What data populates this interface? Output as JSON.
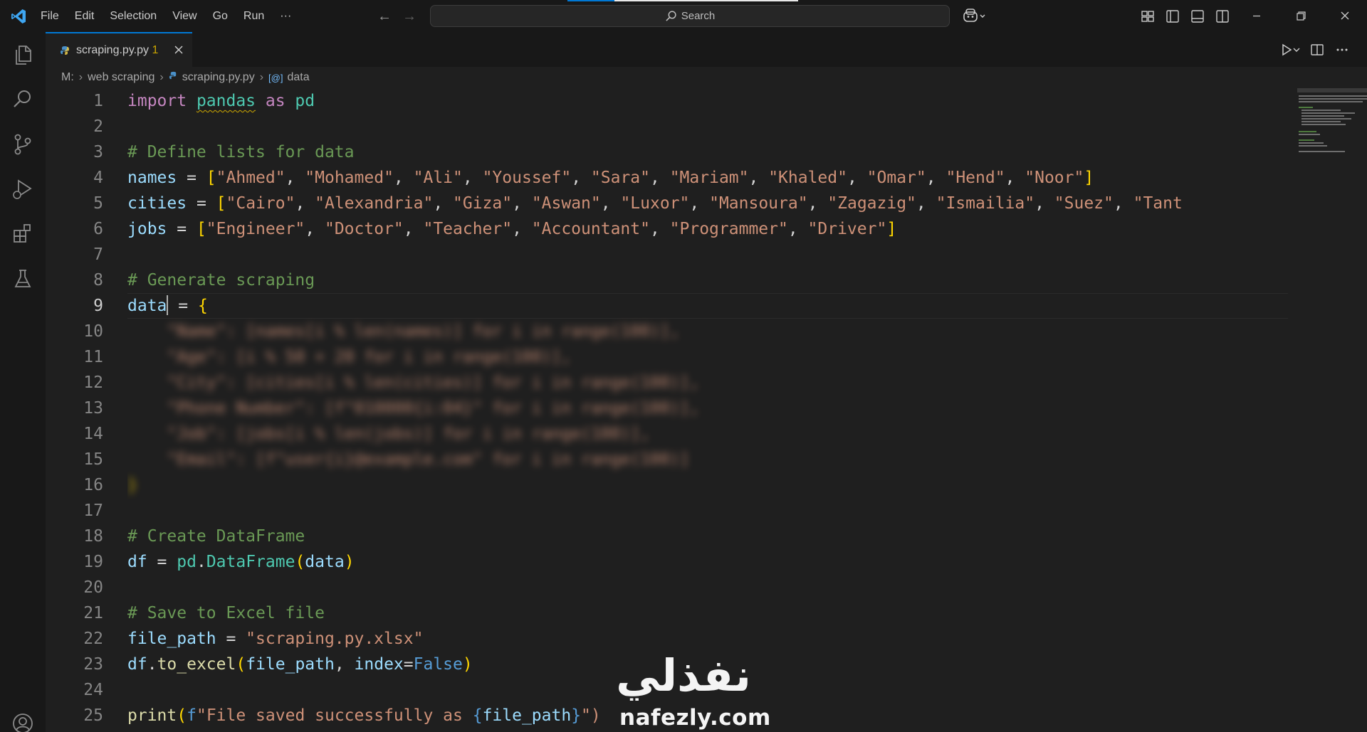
{
  "titlebar": {
    "menu": [
      "File",
      "Edit",
      "Selection",
      "View",
      "Go",
      "Run",
      "···"
    ],
    "search_label": "Search"
  },
  "activity_icons": [
    "explorer-icon",
    "search-icon",
    "source-control-icon",
    "run-debug-icon",
    "extensions-icon",
    "testing-icon",
    "accounts-icon"
  ],
  "tab": {
    "name": "scraping.py.py",
    "problems_count": "1"
  },
  "breadcrumb": {
    "drive": "M:",
    "folder": "web scraping",
    "file": "scraping.py.py",
    "symbol": "data"
  },
  "editor": {
    "current_line": 9,
    "line_numbers": [
      "1",
      "2",
      "3",
      "4",
      "5",
      "6",
      "7",
      "8",
      "9",
      "10",
      "11",
      "12",
      "13",
      "14",
      "15",
      "16",
      "17",
      "18",
      "19",
      "20",
      "21",
      "22",
      "23",
      "24",
      "25"
    ]
  },
  "watermark": {
    "arabic": "نفذلي",
    "latin": "nafezly.com"
  },
  "colors": {
    "accent": "#0078d4",
    "editor_bg": "#1f1f1f",
    "chrome_bg": "#181818"
  }
}
